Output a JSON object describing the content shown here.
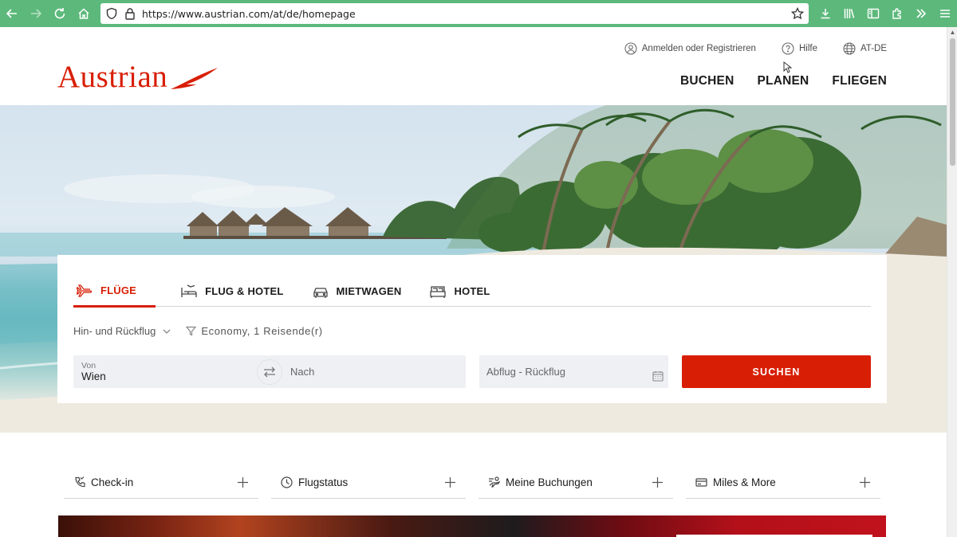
{
  "browser": {
    "url": "https://www.austrian.com/at/de/homepage",
    "toolbar_icons": [
      "back-icon",
      "forward-icon",
      "reload-icon",
      "home-icon",
      "shield-icon",
      "lock-icon",
      "bookmark-star-icon",
      "download-icon",
      "library-icon",
      "sidebar-icon",
      "extensions-icon",
      "overflow-icon",
      "menu-icon"
    ]
  },
  "header": {
    "logo_text": "Austrian",
    "utility": {
      "login": "Anmelden oder Registrieren",
      "help": "Hilfe",
      "locale": "AT-DE"
    },
    "nav": [
      "BUCHEN",
      "PLANEN",
      "FLIEGEN"
    ]
  },
  "booking": {
    "tabs": [
      {
        "label": "FLÜGE",
        "icon": "plane-icon",
        "active": true
      },
      {
        "label": "FLUG & HOTEL",
        "icon": "hotel-bed-icon",
        "active": false
      },
      {
        "label": "MIETWAGEN",
        "icon": "car-icon",
        "active": false
      },
      {
        "label": "HOTEL",
        "icon": "bed-icon",
        "active": false
      }
    ],
    "trip_type": "Hin- und Rückflug",
    "passengers": "Economy, 1 Reisende(r)",
    "from_label": "Von",
    "from_value": "Wien",
    "to_placeholder": "Nach",
    "dates_placeholder": "Abflug - Rückflug",
    "search_label": "SUCHEN"
  },
  "quick_links": [
    {
      "label": "Check-in",
      "icon": "checkin-icon"
    },
    {
      "label": "Flugstatus",
      "icon": "clock-icon"
    },
    {
      "label": "Meine Buchungen",
      "icon": "bookings-icon"
    },
    {
      "label": "Miles & More",
      "icon": "card-icon"
    }
  ],
  "colors": {
    "brand_red": "#d81e05",
    "browser_bar": "#5cb97b"
  }
}
